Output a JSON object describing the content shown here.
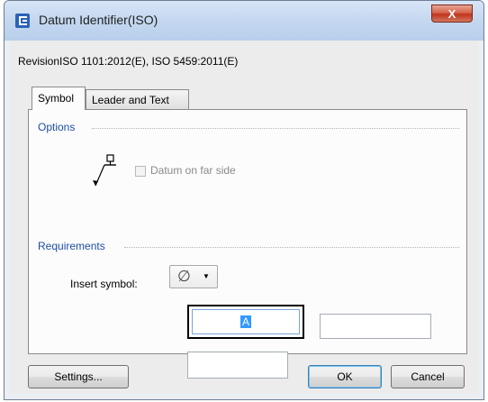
{
  "window": {
    "title": "Datum Identifier(ISO)",
    "close_label": "X"
  },
  "revision_text": "RevisionISO 1101:2012(E), ISO 5459:2011(E)",
  "tabs": [
    {
      "label": "Symbol",
      "active": true
    },
    {
      "label": "Leader and Text",
      "active": false
    }
  ],
  "options": {
    "heading": "Options",
    "datum_far_side_label": "Datum on far side",
    "datum_far_side_checked": false
  },
  "requirements": {
    "heading": "Requirements",
    "insert_symbol_label": "Insert symbol:",
    "symbol_value": "∅",
    "dropdown_arrow": "▼",
    "field_a_value": "A",
    "field_b_value": "",
    "field_c_value": ""
  },
  "buttons": {
    "settings": "Settings...",
    "ok": "OK",
    "cancel": "Cancel"
  }
}
